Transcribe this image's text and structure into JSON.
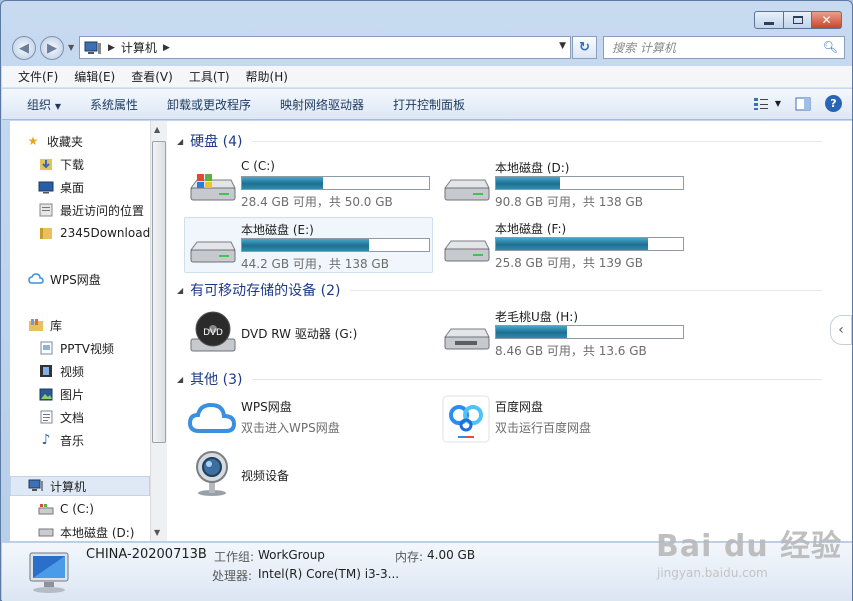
{
  "address": {
    "path": "计算机",
    "search_placeholder": "搜索 计算机"
  },
  "menubar": [
    "文件(F)",
    "编辑(E)",
    "查看(V)",
    "工具(T)",
    "帮助(H)"
  ],
  "toolbar": [
    "组织",
    "系统属性",
    "卸载或更改程序",
    "映射网络驱动器",
    "打开控制面板"
  ],
  "sidebar": {
    "favorites": "收藏夹",
    "fav_items": [
      "下载",
      "桌面",
      "最近访问的位置",
      "2345Downloads"
    ],
    "wps": "WPS网盘",
    "library": "库",
    "lib_items": [
      "PPTV视频",
      "视频",
      "图片",
      "文档",
      "音乐"
    ],
    "computer": "计算机",
    "computer_items": [
      "C (C:)",
      "本地磁盘 (D:)"
    ]
  },
  "groups": {
    "hdd": "硬盘 (4)",
    "removable": "有可移动存储的设备 (2)",
    "other": "其他 (3)"
  },
  "drives": [
    {
      "name": "C (C:)",
      "info": "28.4 GB 可用，共 50.0 GB",
      "used_fraction": 0.432
    },
    {
      "name": "本地磁盘 (D:)",
      "info": "90.8 GB 可用，共 138 GB",
      "used_fraction": 0.342
    },
    {
      "name": "本地磁盘 (E:)",
      "info": "44.2 GB 可用，共 138 GB",
      "used_fraction": 0.68
    },
    {
      "name": "本地磁盘 (F:)",
      "info": "25.8 GB 可用，共 139 GB",
      "used_fraction": 0.814
    }
  ],
  "removable": [
    {
      "name": "DVD RW 驱动器 (G:)",
      "icon_label": "DVD"
    },
    {
      "name": "老毛桃U盘 (H:)",
      "info": "8.46 GB 可用，共 13.6 GB",
      "used_fraction": 0.378
    }
  ],
  "other": [
    {
      "name": "WPS网盘",
      "sub": "双击进入WPS网盘"
    },
    {
      "name": "百度网盘",
      "sub": "双击运行百度网盘"
    },
    {
      "name": "视频设备"
    }
  ],
  "details": {
    "computer_name": "CHINA-20200713B",
    "workgroup_label": "工作组:",
    "workgroup": "WorkGroup",
    "memory_label": "内存:",
    "memory": "4.00 GB",
    "cpu_label": "处理器:",
    "cpu": "Intel(R) Core(TM) i3-3..."
  },
  "watermark": {
    "main": "Bai du 经验",
    "sub": "jingyan.baidu.com"
  },
  "colors": {
    "accent": "#1e3a8a",
    "bar": "#2e8ab0"
  }
}
